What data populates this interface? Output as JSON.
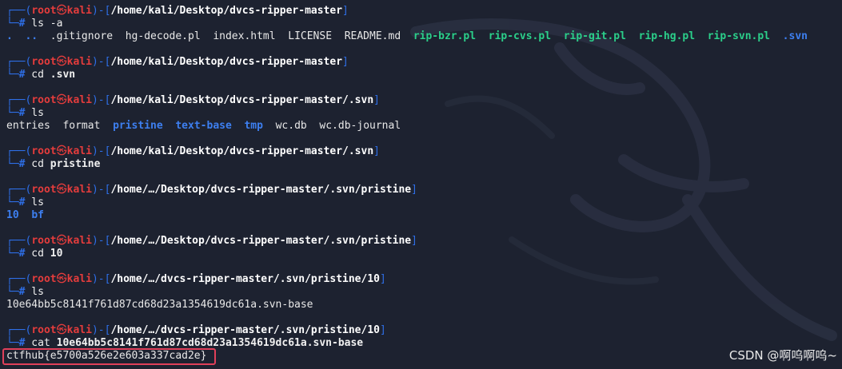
{
  "prompt": {
    "user": "root",
    "at": "㉿",
    "host": "kali",
    "hash": "#"
  },
  "blocks": [
    {
      "path": "/home/kali/Desktop/dvcs-ripper-master",
      "cmd": "ls",
      "arg": "-a",
      "output": [
        {
          "text": ".",
          "type": "dir"
        },
        {
          "text": "..",
          "type": "dir"
        },
        {
          "text": ".gitignore",
          "type": "plain"
        },
        {
          "text": "hg-decode.pl",
          "type": "plain"
        },
        {
          "text": "index.html",
          "type": "plain"
        },
        {
          "text": "LICENSE",
          "type": "plain"
        },
        {
          "text": "README.md",
          "type": "plain"
        },
        {
          "text": "rip-bzr.pl",
          "type": "exe"
        },
        {
          "text": "rip-cvs.pl",
          "type": "exe"
        },
        {
          "text": "rip-git.pl",
          "type": "exe"
        },
        {
          "text": "rip-hg.pl",
          "type": "exe"
        },
        {
          "text": "rip-svn.pl",
          "type": "exe"
        },
        {
          "text": ".svn",
          "type": "dir"
        }
      ]
    },
    {
      "path": "/home/kali/Desktop/dvcs-ripper-master",
      "cmd": "cd",
      "arg": ".svn",
      "output": []
    },
    {
      "path": "/home/kali/Desktop/dvcs-ripper-master/.svn",
      "cmd": "ls",
      "arg": "",
      "output": [
        {
          "text": "entries",
          "type": "plain"
        },
        {
          "text": "format",
          "type": "plain"
        },
        {
          "text": "pristine",
          "type": "dir"
        },
        {
          "text": "text-base",
          "type": "dir"
        },
        {
          "text": "tmp",
          "type": "dir"
        },
        {
          "text": "wc.db",
          "type": "plain"
        },
        {
          "text": "wc.db-journal",
          "type": "plain"
        }
      ]
    },
    {
      "path": "/home/kali/Desktop/dvcs-ripper-master/.svn",
      "cmd": "cd",
      "arg": "pristine",
      "output": []
    },
    {
      "path": "/home/…/Desktop/dvcs-ripper-master/.svn/pristine",
      "cmd": "ls",
      "arg": "",
      "output": [
        {
          "text": "10",
          "type": "dir"
        },
        {
          "text": "bf",
          "type": "dir"
        }
      ]
    },
    {
      "path": "/home/…/Desktop/dvcs-ripper-master/.svn/pristine",
      "cmd": "cd",
      "arg": "10",
      "output": []
    },
    {
      "path": "/home/…/dvcs-ripper-master/.svn/pristine/10",
      "cmd": "ls",
      "arg": "",
      "output": [
        {
          "text": "10e64bb5c8141f761d87cd68d23a1354619dc61a.svn-base",
          "type": "plain"
        }
      ]
    },
    {
      "path": "/home/…/dvcs-ripper-master/.svn/pristine/10",
      "cmd": "cat",
      "arg": "10e64bb5c8141f761d87cd68d23a1354619dc61a.svn-base",
      "output": [
        {
          "text": "ctfhub{e5700a526e2e603a337cad2e}",
          "type": "plain"
        }
      ]
    }
  ],
  "watermark": "CSDN @啊呜啊呜~"
}
